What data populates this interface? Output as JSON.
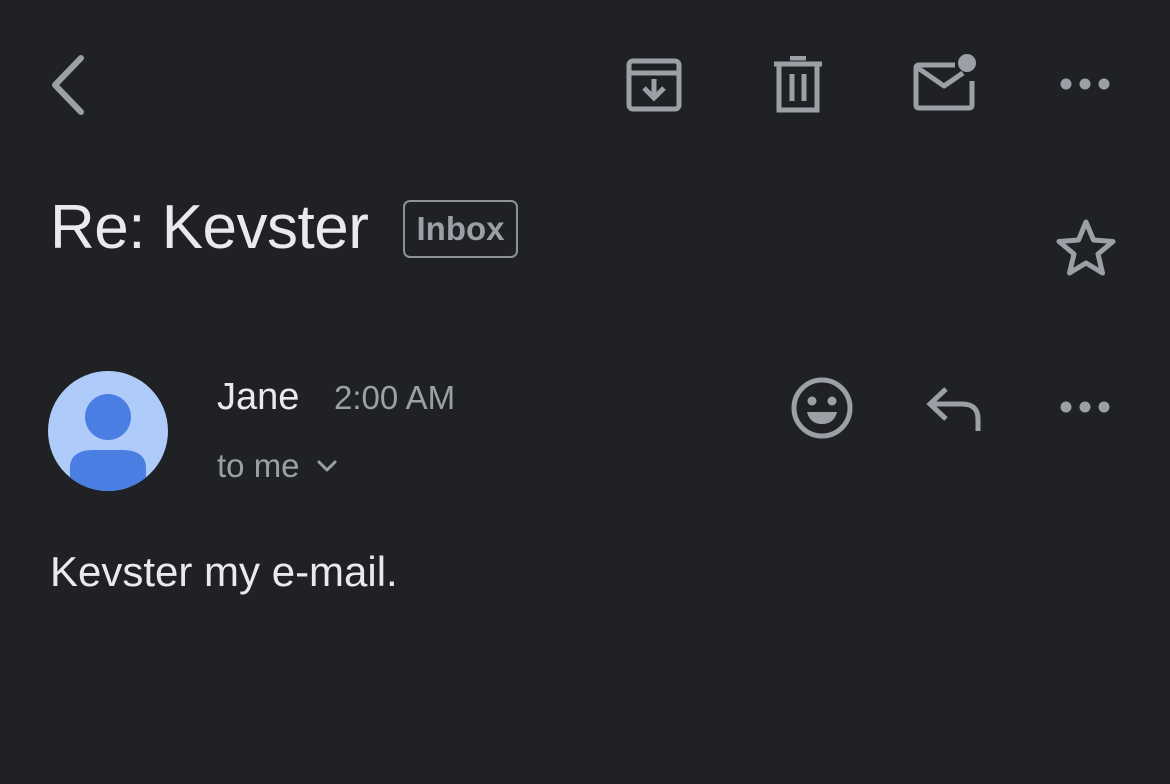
{
  "toolbar": {
    "back_icon": "chevron-left-icon",
    "archive_icon": "archive-icon",
    "delete_icon": "trash-icon",
    "mark_unread_icon": "mail-unread-icon",
    "more_icon": "more-horizontal-icon"
  },
  "message": {
    "subject": "Re: Kevster",
    "label": "Inbox",
    "star_icon": "star-outline-icon",
    "sender": "Jane",
    "time": "2:00 AM",
    "recipients": "to me",
    "recipients_toggle_icon": "chevron-down-icon",
    "reaction_icon": "emoji-smile-icon",
    "reply_icon": "reply-icon",
    "more_icon": "more-horizontal-icon",
    "body": "Kevster my e-mail."
  },
  "colors": {
    "background": "#202124",
    "primary_text": "#e8eaed",
    "secondary_text": "#9aa0a6",
    "icon": "#9aa0a6",
    "avatar_background": "#aecbfa",
    "avatar_figure": "#4a7ee3"
  }
}
